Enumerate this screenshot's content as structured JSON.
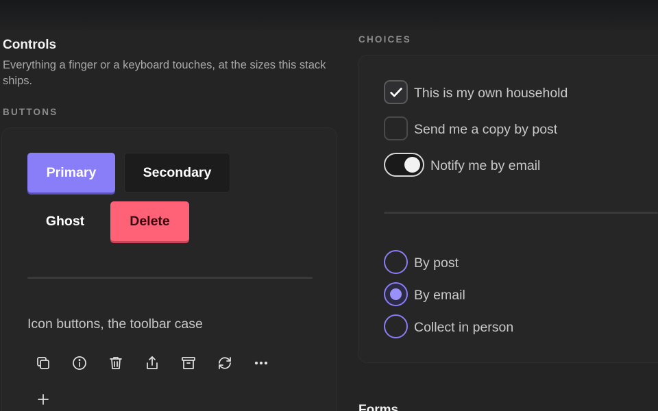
{
  "controls": {
    "title": "Controls",
    "description": "Everything a finger or a keyboard touches, at the sizes this stack ships."
  },
  "buttons": {
    "section_label": "BUTTONS",
    "primary_label": "Primary",
    "secondary_label": "Secondary",
    "ghost_label": "Ghost",
    "delete_label": "Delete",
    "icon_buttons_heading": "Icon buttons, the toolbar case",
    "toolbar_icons": [
      "copy-icon",
      "info-icon",
      "trash-icon",
      "share-icon",
      "archive-icon",
      "refresh-icon",
      "more-icon",
      "plus-icon"
    ]
  },
  "choices": {
    "section_label": "CHOICES",
    "checkboxes": [
      {
        "label": "This is my own household",
        "checked": true
      },
      {
        "label": "Send me a copy by post",
        "checked": false
      }
    ],
    "toggle": {
      "label": "Notify me by email",
      "on": true
    },
    "radios": [
      {
        "label": "By post",
        "selected": false
      },
      {
        "label": "By email",
        "selected": true
      },
      {
        "label": "Collect in person",
        "selected": false
      }
    ]
  },
  "forms": {
    "title": "Forms"
  },
  "colors": {
    "accent": "#8a7ef8",
    "danger": "#ff6177",
    "background": "#242425"
  }
}
